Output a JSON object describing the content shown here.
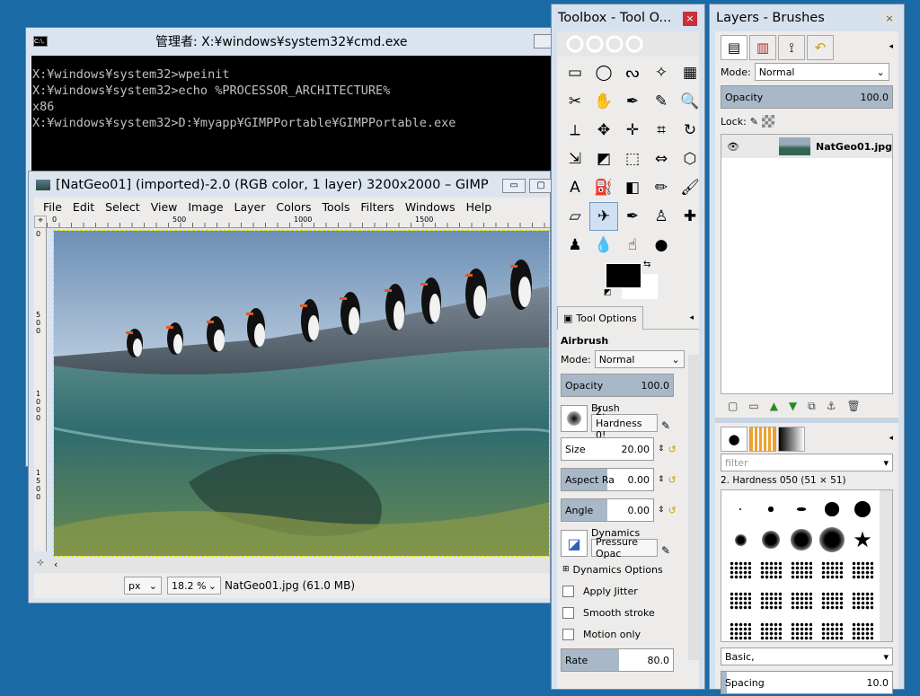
{
  "cmd": {
    "title": "管理者: X:¥windows¥system32¥cmd.exe",
    "icon_label": "C:\\.",
    "lines": [
      "",
      "X:¥windows¥system32>wpeinit",
      "",
      "X:¥windows¥system32>echo %PROCESSOR_ARCHITECTURE%",
      "x86",
      "",
      "X:¥windows¥system32>D:¥myapp¥GIMPPortable¥GIMPPortable.exe"
    ]
  },
  "gimp": {
    "title": "[NatGeo01] (imported)-2.0 (RGB color, 1 layer) 3200x2000 – GIMP",
    "menu": [
      "File",
      "Edit",
      "Select",
      "View",
      "Image",
      "Layer",
      "Colors",
      "Tools",
      "Filters",
      "Windows",
      "Help"
    ],
    "ruler_h": [
      "0",
      "500",
      "1000"
    ],
    "ruler_v": [
      "0",
      "5 0 0",
      "1 0 0 0",
      "1 5 0 0"
    ],
    "unit": "px",
    "zoom": "18.2 %",
    "status": "NatGeo01.jpg (61.0 MB)"
  },
  "toolbox": {
    "title": "Toolbox - Tool O...",
    "tool_icons": [
      "rect-select-icon",
      "ellipse-select-icon",
      "free-select-icon",
      "fuzzy-select-icon",
      "color-select-icon",
      "scissors-icon",
      "foreground-select-icon",
      "paths-icon",
      "color-picker-icon",
      "zoom-icon",
      "measure-icon",
      "move-icon",
      "align-icon",
      "crop-icon",
      "rotate-icon",
      "scale-icon",
      "shear-icon",
      "perspective-icon",
      "flip-icon",
      "cage-icon",
      "text-icon",
      "bucket-fill-icon",
      "blend-icon",
      "pencil-icon",
      "paintbrush-icon",
      "eraser-icon",
      "airbrush-icon",
      "ink-icon",
      "clone-icon",
      "heal-icon",
      "perspective-clone-icon",
      "blur-icon",
      "smudge-icon",
      "dodge-burn-icon"
    ],
    "tool_glyphs": [
      "▭",
      "◯",
      "ᔓ",
      "✧",
      "▦",
      "✂",
      "✋",
      "✒",
      "✎",
      "🔍",
      "⟂",
      "✥",
      "✛",
      "⌗",
      "↻",
      "⇲",
      "◩",
      "⬚",
      "⇔",
      "⬡",
      "A",
      "⛽",
      "◧",
      "✏",
      "🖌",
      "▱",
      "✈",
      "✒",
      "♙",
      "✚",
      "♟",
      "💧",
      "☝",
      "●"
    ],
    "selected_tool_index": 26,
    "options_tab": "Tool Options",
    "tool_name": "Airbrush",
    "mode_label": "Mode:",
    "mode_value": "Normal",
    "opacity_label": "Opacity",
    "opacity_value": "100.0",
    "brush_label": "Brush",
    "brush_value": "2. Hardness 0!",
    "size_label": "Size",
    "size_value": "20.00",
    "aspect_label": "Aspect Ra",
    "aspect_value": "0.00",
    "angle_label": "Angle",
    "angle_value": "0.00",
    "dynamics_label": "Dynamics",
    "dynamics_value": "Pressure Opac",
    "dynamics_options": "Dynamics Options",
    "apply_jitter": "Apply Jitter",
    "smooth_stroke": "Smooth stroke",
    "motion_only": "Motion only",
    "rate_label": "Rate",
    "rate_value": "80.0"
  },
  "layers": {
    "title": "Layers - Brushes",
    "mode_label": "Mode:",
    "mode_value": "Normal",
    "opacity_label": "Opacity",
    "opacity_value": "100.0",
    "lock_label": "Lock:",
    "layer_name": "NatGeo01.jpg",
    "filter_placeholder": "filter",
    "brush_info": "2. Hardness 050 (51 × 51)",
    "brush_set": "Basic,",
    "spacing_label": "Spacing",
    "spacing_value": "10.0"
  }
}
